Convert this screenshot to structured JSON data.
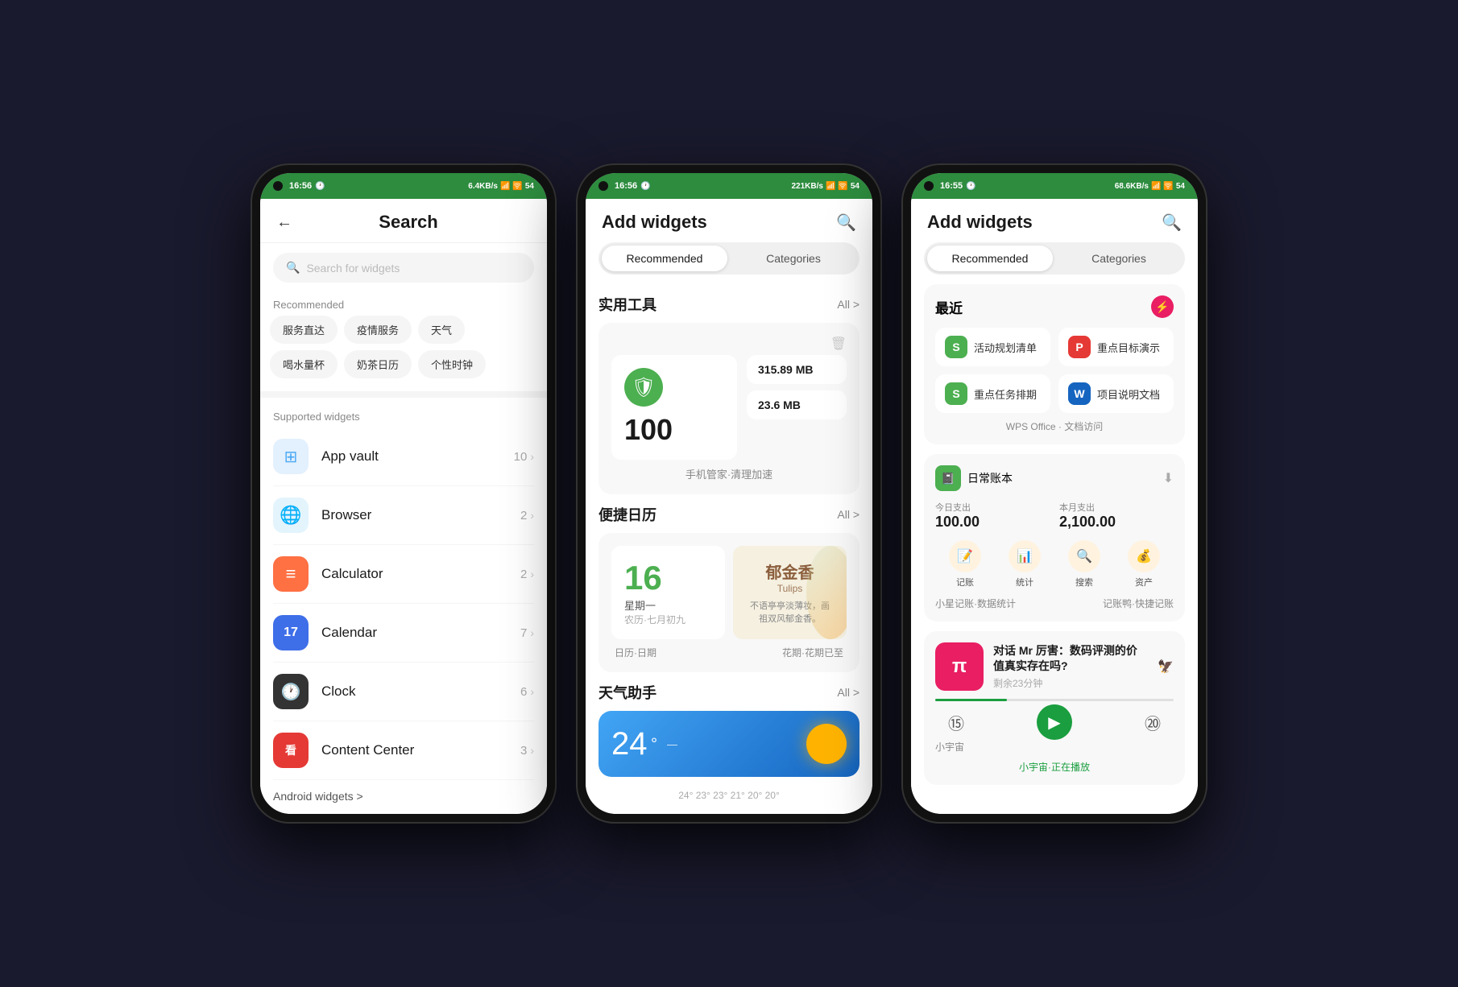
{
  "phone1": {
    "status": {
      "time": "16:56",
      "network": "6.4KB/s",
      "signal": "📶",
      "wifi": "🛜",
      "battery": "54"
    },
    "header": {
      "back": "←",
      "title": "Search"
    },
    "searchbar": {
      "placeholder": "Search for widgets"
    },
    "recommended_label": "Recommended",
    "tags": [
      "服务直达",
      "疫情服务",
      "天气",
      "喝水量杯",
      "奶茶日历",
      "个性时钟"
    ],
    "supported_label": "Supported widgets",
    "widgets": [
      {
        "name": "App vault",
        "count": "10",
        "color": "#4BAAF5",
        "bg": "#e3f0fd",
        "icon": "⊞"
      },
      {
        "name": "Browser",
        "count": "2",
        "color": "#4BAAF5",
        "bg": "#e3f4fd",
        "icon": "🌐"
      },
      {
        "name": "Calculator",
        "count": "2",
        "color": "#FF7043",
        "bg": "#fce8e1",
        "icon": "≡"
      },
      {
        "name": "Calendar",
        "count": "7",
        "color": "#3E6EE8",
        "bg": "#e8ecfc",
        "icon": "17"
      },
      {
        "name": "Clock",
        "count": "6",
        "color": "#555",
        "bg": "#f0f0f0",
        "icon": "🕐"
      },
      {
        "name": "Content Center",
        "count": "3",
        "color": "#e53935",
        "bg": "#fce8e8",
        "icon": "看"
      }
    ],
    "android_widgets": "Android widgets >"
  },
  "phone2": {
    "status": {
      "time": "16:56",
      "network": "221KB/s"
    },
    "header": {
      "title": "Add widgets",
      "search_icon": "🔍"
    },
    "tabs": [
      "Recommended",
      "Categories"
    ],
    "active_tab": 0,
    "sections": [
      {
        "title": "实用工具",
        "all_label": "All >",
        "items": [
          {
            "type": "cleaner",
            "number": "100",
            "stat1": "315.89 MB",
            "stat2": "23.6 MB",
            "label": "手机管家·清理加速"
          }
        ]
      },
      {
        "title": "便捷日历",
        "all_label": "All >",
        "items": [
          {
            "type": "calendar",
            "day": "16",
            "weekday": "星期一",
            "lunar": "农历·七月初九",
            "flower": "郁金香",
            "flower_en": "Tulips",
            "flower_desc": "不语亭亭淡薄妆，画祖双风郁金香。",
            "label1": "日历·日期",
            "label2": "花期·花期已至"
          }
        ]
      },
      {
        "title": "天气助手",
        "all_label": "All >",
        "items": [
          {
            "type": "weather",
            "temp": "24",
            "desc": "—",
            "temps_row": "24° 23° 23° 21° 20° 20°"
          }
        ]
      }
    ]
  },
  "phone3": {
    "status": {
      "time": "16:55",
      "network": "68.6KB/s"
    },
    "header": {
      "title": "Add widgets",
      "search_icon": "🔍"
    },
    "tabs": [
      "Recommended",
      "Categories"
    ],
    "active_tab": 0,
    "recent_title": "最近",
    "recent_badge": "⚡",
    "apps": [
      {
        "name": "活动规划清单",
        "color": "#4CAF50",
        "letter": "S"
      },
      {
        "name": "重点目标演示",
        "color": "#e53935",
        "letter": "P"
      },
      {
        "name": "重点任务排期",
        "color": "#4CAF50",
        "letter": "S"
      },
      {
        "name": "项目说明文档",
        "color": "#1565C0",
        "letter": "W"
      }
    ],
    "wps_label": "WPS Office · 文档访问",
    "account": {
      "name": "日常账本",
      "label1": "今日支出",
      "val1": "100.00",
      "label2": "本月支出",
      "val2": "2,100.00",
      "actions": [
        "记账",
        "统计",
        "搜索",
        "资产"
      ],
      "footer1": "小星记账·数据统计",
      "footer2": "记账鸭·快捷记账"
    },
    "podcast": {
      "thumb_icon": "π",
      "title": "对话 Mr 厉害：数码评测的价值真实存在吗?",
      "countdown": "剩余23分钟",
      "host": "小宇宙",
      "playing": "小宇宙·正在播放"
    }
  }
}
